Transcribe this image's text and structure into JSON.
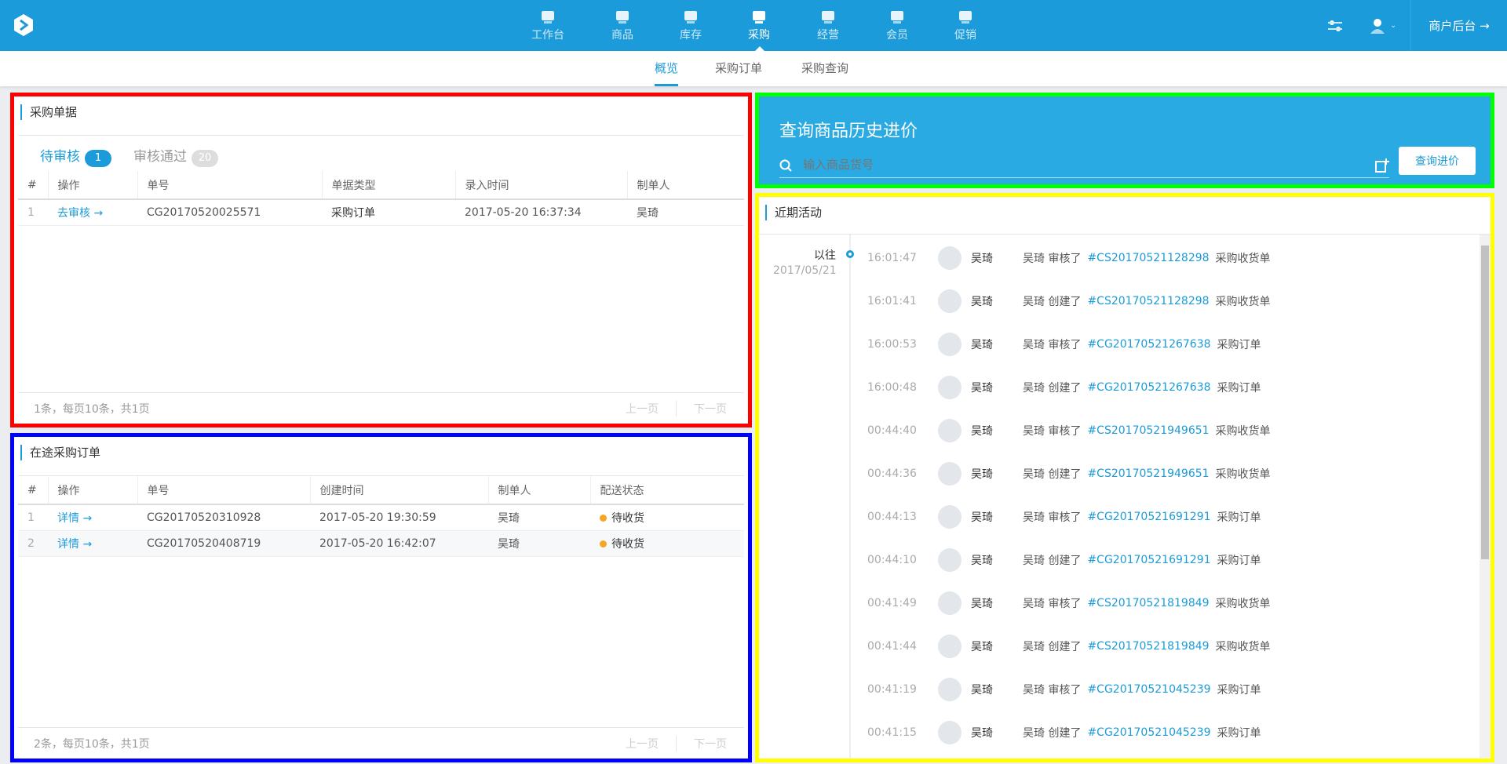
{
  "topbar": {
    "nav": [
      {
        "label": "工作台",
        "icon": "monitor-icon"
      },
      {
        "label": "商品",
        "icon": "gift-icon"
      },
      {
        "label": "库存",
        "icon": "warehouse-icon"
      },
      {
        "label": "采购",
        "icon": "cart-icon",
        "active": true
      },
      {
        "label": "经营",
        "icon": "store-icon"
      },
      {
        "label": "会员",
        "icon": "crown-icon"
      },
      {
        "label": "促销",
        "icon": "coupon-icon"
      }
    ],
    "merchant_label": "商户后台 →"
  },
  "subnav": {
    "tabs": [
      "概览",
      "采购订单",
      "采购查询"
    ]
  },
  "purchase_docs": {
    "title": "采购单据",
    "tabs": [
      {
        "label": "待审核",
        "count": "1"
      },
      {
        "label": "审核通过",
        "count": "20"
      }
    ],
    "columns": [
      "#",
      "操作",
      "单号",
      "单据类型",
      "录入时间",
      "制单人"
    ],
    "rows": [
      [
        "1",
        "去审核 →",
        "CG20170520025571",
        "采购订单",
        "2017-05-20 16:37:34",
        "吴琦"
      ]
    ],
    "footer": "1条，每页10条，共1页",
    "prev": "上一页",
    "next": "下一页"
  },
  "transit_orders": {
    "title": "在途采购订单",
    "columns": [
      "#",
      "操作",
      "单号",
      "创建时间",
      "制单人",
      "配送状态"
    ],
    "rows": [
      [
        "1",
        "详情 →",
        "CG20170520310928",
        "2017-05-20 19:30:59",
        "吴琦",
        "待收货"
      ],
      [
        "2",
        "详情 →",
        "CG20170520408719",
        "2017-05-20 16:42:07",
        "吴琦",
        "待收货"
      ]
    ],
    "footer": "2条，每页10条，共1页",
    "prev": "上一页",
    "next": "下一页"
  },
  "price_query": {
    "title": "查询商品历史进价",
    "placeholder": "输入商品货号",
    "button": "查询进价"
  },
  "activity": {
    "title": "近期活动",
    "group_label": "以往",
    "group_date": "2017/05/21",
    "items": [
      {
        "time": "16:01:47",
        "user": "吴琦",
        "action": "吴琦 审核了",
        "id": "#CS20170521128298",
        "type": "采购收货单"
      },
      {
        "time": "16:01:41",
        "user": "吴琦",
        "action": "吴琦 创建了",
        "id": "#CS20170521128298",
        "type": "采购收货单"
      },
      {
        "time": "16:00:53",
        "user": "吴琦",
        "action": "吴琦 审核了",
        "id": "#CG20170521267638",
        "type": "采购订单"
      },
      {
        "time": "16:00:48",
        "user": "吴琦",
        "action": "吴琦 创建了",
        "id": "#CG20170521267638",
        "type": "采购订单"
      },
      {
        "time": "00:44:40",
        "user": "吴琦",
        "action": "吴琦 审核了",
        "id": "#CS20170521949651",
        "type": "采购收货单"
      },
      {
        "time": "00:44:36",
        "user": "吴琦",
        "action": "吴琦 创建了",
        "id": "#CS20170521949651",
        "type": "采购收货单"
      },
      {
        "time": "00:44:13",
        "user": "吴琦",
        "action": "吴琦 审核了",
        "id": "#CG20170521691291",
        "type": "采购订单"
      },
      {
        "time": "00:44:10",
        "user": "吴琦",
        "action": "吴琦 创建了",
        "id": "#CG20170521691291",
        "type": "采购订单"
      },
      {
        "time": "00:41:49",
        "user": "吴琦",
        "action": "吴琦 审核了",
        "id": "#CS20170521819849",
        "type": "采购收货单"
      },
      {
        "time": "00:41:44",
        "user": "吴琦",
        "action": "吴琦 创建了",
        "id": "#CS20170521819849",
        "type": "采购收货单"
      },
      {
        "time": "00:41:19",
        "user": "吴琦",
        "action": "吴琦 审核了",
        "id": "#CG20170521045239",
        "type": "采购订单"
      },
      {
        "time": "00:41:15",
        "user": "吴琦",
        "action": "吴琦 创建了",
        "id": "#CG20170521045239",
        "type": "采购订单"
      }
    ]
  },
  "colors": {
    "brand": "#1b9bd9",
    "query_bg": "#2aaae2",
    "pending": "#f5a623"
  }
}
